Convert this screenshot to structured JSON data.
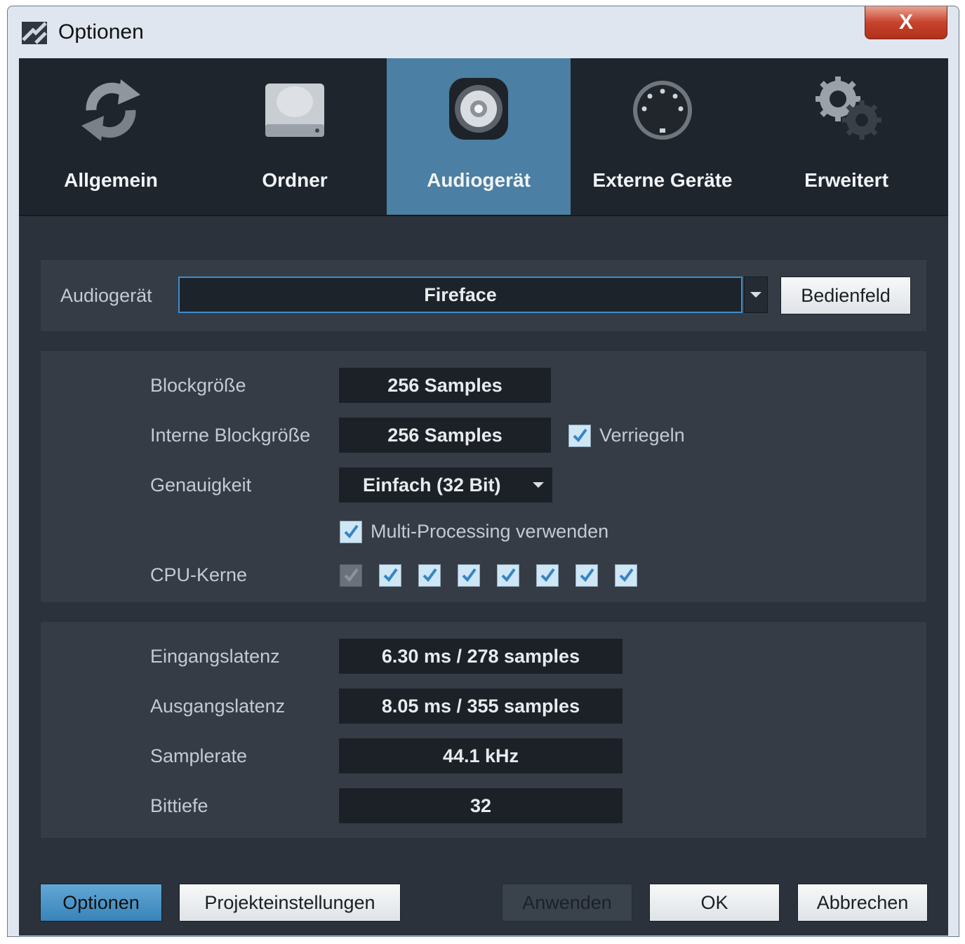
{
  "window": {
    "title": "Optionen",
    "close_label": "X"
  },
  "tabs": [
    {
      "label": "Allgemein",
      "icon": "refresh-icon"
    },
    {
      "label": "Ordner",
      "icon": "drive-icon"
    },
    {
      "label": "Audiogerät",
      "icon": "speaker-icon",
      "active": true
    },
    {
      "label": "Externe Geräte",
      "icon": "midi-connector-icon"
    },
    {
      "label": "Erweitert",
      "icon": "gears-icon"
    }
  ],
  "audio_device": {
    "label": "Audiogerät",
    "value": "Fireface",
    "panel_button": "Bedienfeld"
  },
  "buffer": {
    "block_size_label": "Blockgröße",
    "block_size_value": "256 Samples",
    "internal_block_size_label": "Interne Blockgröße",
    "internal_block_size_value": "256 Samples",
    "lock_label": "Verriegeln",
    "lock_checked": true,
    "precision_label": "Genauigkeit",
    "precision_value": "Einfach (32 Bit)",
    "multiprocessing_label": "Multi-Processing verwenden",
    "multiprocessing_checked": true,
    "cpu_cores_label": "CPU-Kerne",
    "cpu_cores": [
      {
        "checked": true,
        "enabled": false
      },
      {
        "checked": true,
        "enabled": true
      },
      {
        "checked": true,
        "enabled": true
      },
      {
        "checked": true,
        "enabled": true
      },
      {
        "checked": true,
        "enabled": true
      },
      {
        "checked": true,
        "enabled": true
      },
      {
        "checked": true,
        "enabled": true
      },
      {
        "checked": true,
        "enabled": true
      }
    ]
  },
  "latency": {
    "input_label": "Eingangslatenz",
    "input_value": "6.30 ms / 278 samples",
    "output_label": "Ausgangslatenz",
    "output_value": "8.05 ms / 355 samples",
    "samplerate_label": "Samplerate",
    "samplerate_value": "44.1 kHz",
    "bitdepth_label": "Bittiefe",
    "bitdepth_value": "32"
  },
  "footer": {
    "options": "Optionen",
    "project_settings": "Projekteinstellungen",
    "apply": "Anwenden",
    "ok": "OK",
    "cancel": "Abbrechen"
  },
  "colors": {
    "accent": "#4b7fa3",
    "background": "#2b323b",
    "panel": "#353c46",
    "tabbar": "#1f252d"
  }
}
